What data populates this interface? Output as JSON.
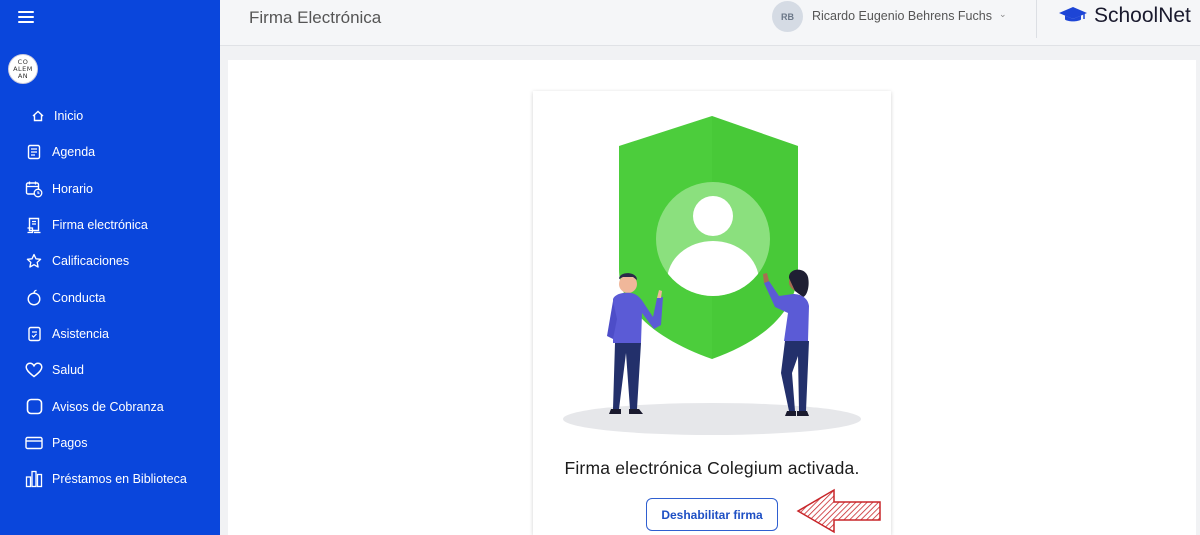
{
  "sidebar": {
    "logo_text": "CO\nALEM\nAN",
    "items": [
      {
        "label": "Inicio",
        "icon": "home-icon"
      },
      {
        "label": "Agenda",
        "icon": "agenda-icon"
      },
      {
        "label": "Horario",
        "icon": "calendar-clock-icon"
      },
      {
        "label": "Firma electrónica",
        "icon": "signature-document-icon"
      },
      {
        "label": "Calificaciones",
        "icon": "star-icon"
      },
      {
        "label": "Conducta",
        "icon": "apple-icon"
      },
      {
        "label": "Asistencia",
        "icon": "attendance-icon"
      },
      {
        "label": "Salud",
        "icon": "heart-icon"
      },
      {
        "label": "Avisos de Cobranza",
        "icon": "square-icon"
      },
      {
        "label": "Pagos",
        "icon": "credit-card-icon"
      },
      {
        "label": "Préstamos en Biblioteca",
        "icon": "library-icon"
      }
    ]
  },
  "header": {
    "title": "Firma Electrónica",
    "user_initials": "RB",
    "user_name": "Ricardo Eugenio Behrens Fuchs",
    "brand": "SchoolNet"
  },
  "main": {
    "status_text": "Firma electrónica Colegium activada.",
    "disable_button_label": "Deshabilitar firma"
  },
  "colors": {
    "sidebar_bg": "#0a46dc",
    "shield_green": "#4ccd3c",
    "person_blue": "#5b5bd6",
    "arrow_red": "#c8262a"
  }
}
